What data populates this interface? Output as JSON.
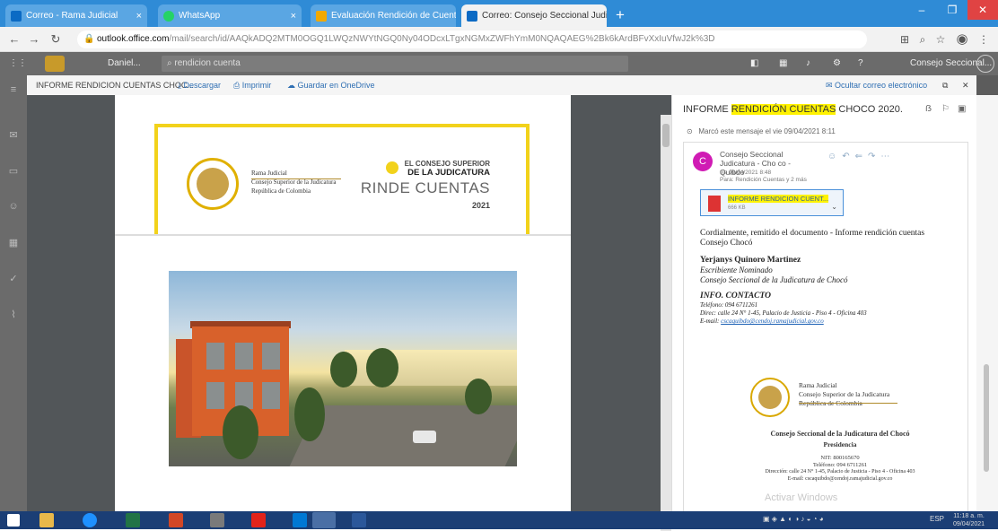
{
  "browser": {
    "tabs": [
      {
        "title": "Correo - Rama Judicial",
        "active": false
      },
      {
        "title": "WhatsApp",
        "active": false
      },
      {
        "title": "Evaluación Rendición de Cuentas",
        "active": false
      },
      {
        "title": "Correo: Consejo Seccional Judi...",
        "active": true
      }
    ],
    "url_host": "outlook.office.com",
    "url_path": "/mail/search/id/AAQkADQ2MTM0OGQ1LWQzNWYtNGQ0Ny04ODcxLTgxNGMxZWFhYmM0NQAQAEG%2Bk6kArdBFvXxIuVfwJ2k%3D"
  },
  "owa": {
    "app_name": "Outlook",
    "account": "Daniel...",
    "search_text": "rendicion cuenta",
    "right_label": "Consejo Seccional..."
  },
  "viewer": {
    "filename": "INFORME RENDICION CUENTAS CHOC...",
    "download": "Descargar",
    "print": "Imprimir",
    "save": "Guardar en OneDrive",
    "close_attachment": "Ocultar correo electrónico"
  },
  "pdf": {
    "rama_line1": "Rama Judicial",
    "rama_line2": "Consejo Superior de la Judicatura",
    "rama_line3": "República de Colombia",
    "cs_line1": "EL CONSEJO SUPERIOR",
    "cs_line2": "DE LA JUDICATURA",
    "rinde": "RINDE CUENTAS",
    "year": "2021"
  },
  "mail": {
    "subject_pre": "INFORME ",
    "subject_hl": "RENDICIÓN CUENTAS",
    "subject_post": " CHOCO 2020.",
    "expand_text": "Marcó este mensaje el vie 09/04/2021 8:11",
    "avatar_letter": "C",
    "from": "Consejo Seccional Judicatura - Cho co - Quibdo",
    "date": "vie 09/04/2021 8:48",
    "to": "Para: Rendición Cuentas y 2 más",
    "attachment_name": "INFORME RENDICION CUENT...",
    "attachment_size": "666 KB",
    "greeting": "Cordialmente, remitido el documento - Informe rendición cuentas",
    "greeting2": "Consejo Chocó",
    "signer": "Yerjanys Quinoro Martinez",
    "role1": "Escribiente Nominado",
    "role2": "Consejo Seccional de la Judicatura de Chocó",
    "info_title": "INFO. CONTACTO",
    "phone": "Teléfono: 094 6711261",
    "address": "Direc: calle 24 N° 1-45, Palacio de Justicia - Piso 4 - Oficina 403",
    "email_label": "E-mail:",
    "email": "cscaquibdo@cendoj.ramajudicial.gov.co",
    "sig_rama1": "Rama Judicial",
    "sig_rama2": "Consejo Superior de la Judicatura",
    "sig_rama3": "República de Colombia",
    "sig_title": "Consejo Seccional de la Judicatura del Chocó",
    "sig_sub": "Presidencia",
    "sig_nit": "NIT: 800165670",
    "sig_tel": "Teléfono: 094 6711261",
    "sig_addr": "Dirección: calle 24 N° 1-45, Palacio de Justicia - Piso 4 - Oficina 403",
    "sig_web": "E-mail: cscaquibdo@cendoj.ramajudicial.gov.co",
    "watermark": "Activar Windows"
  },
  "taskbar": {
    "time": "11:18 a. m.",
    "date": "09/04/2021",
    "lang": "ESP"
  },
  "colors": {
    "tabstrip": "#2f8bd6",
    "taskbar": "#1b3e75",
    "highlight": "#fff200",
    "frame_yellow": "#f2d21b",
    "avatar": "#d01bb4"
  }
}
